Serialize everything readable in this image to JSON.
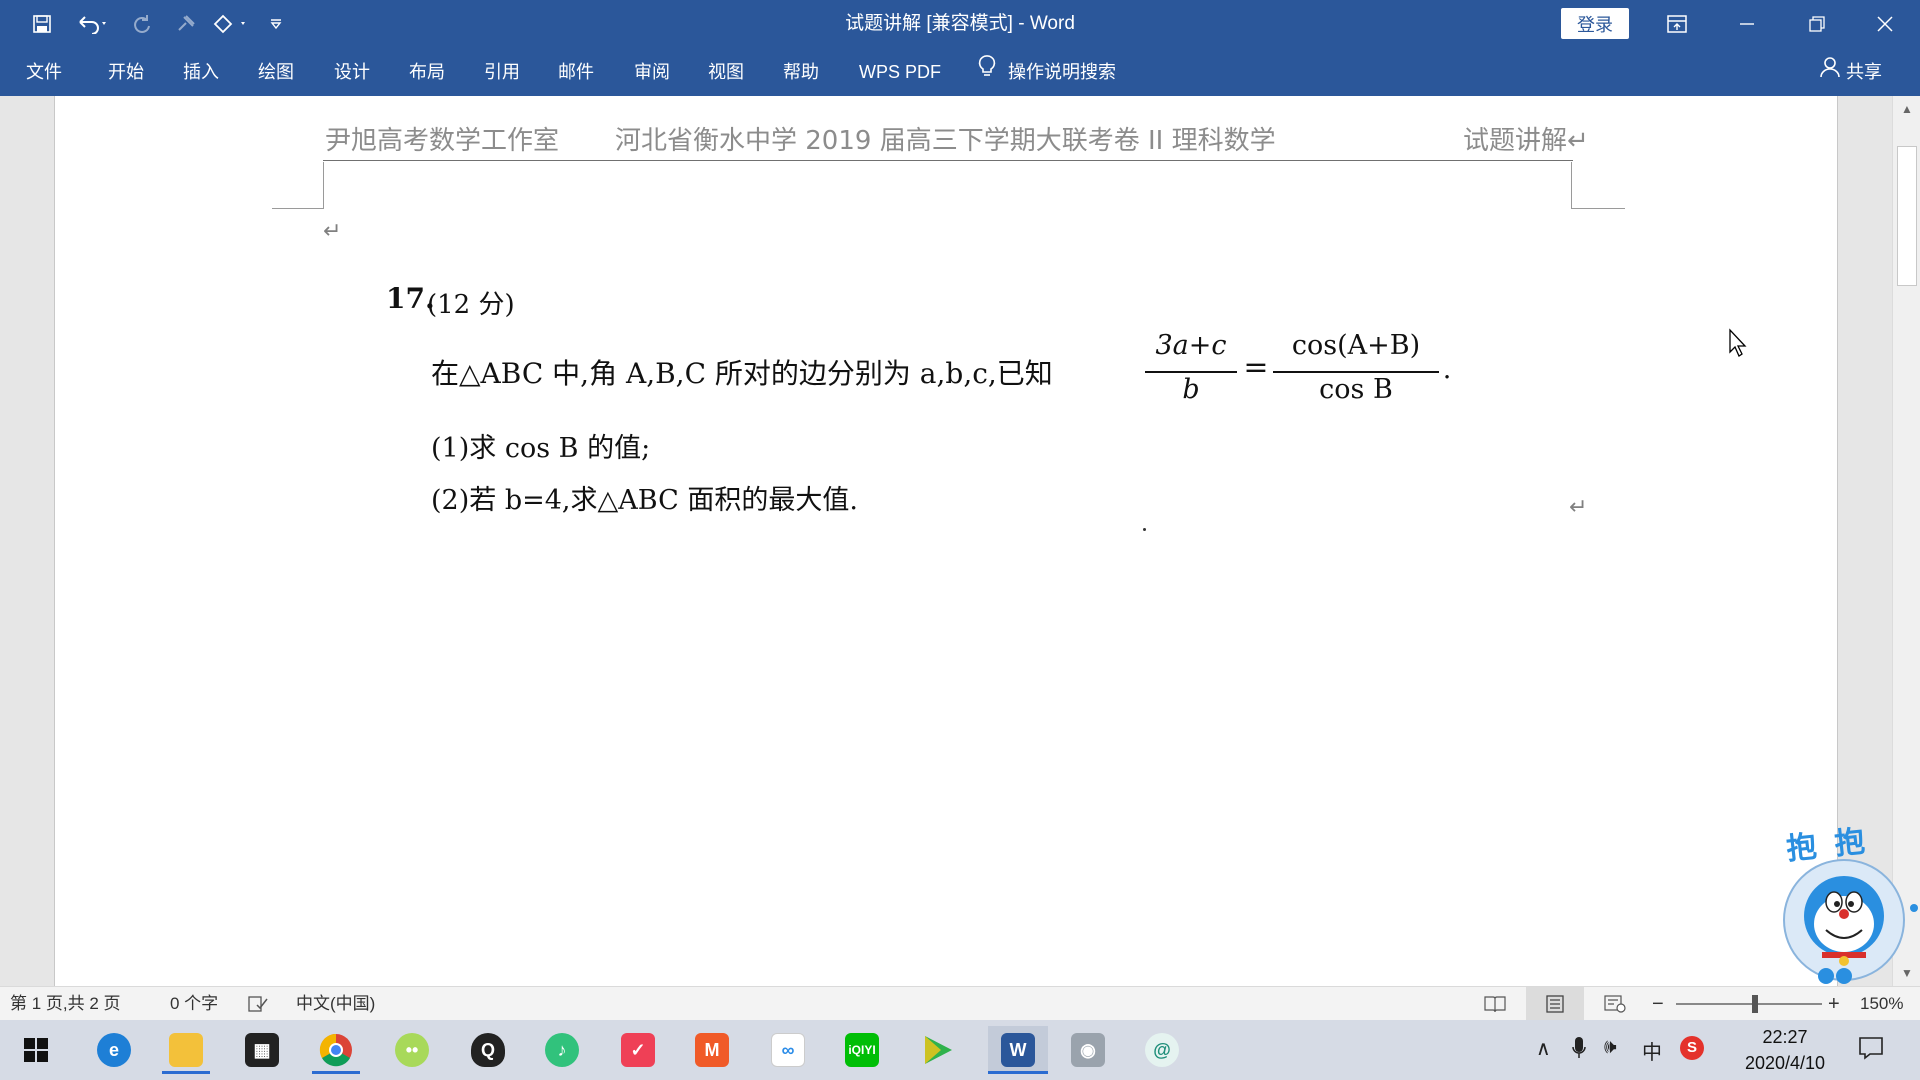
{
  "window": {
    "title": "试题讲解 [兼容模式]  -  Word",
    "login_label": "登录"
  },
  "ribbon": {
    "tabs": [
      "文件",
      "开始",
      "插入",
      "绘图",
      "设计",
      "布局",
      "引用",
      "邮件",
      "审阅",
      "视图",
      "帮助",
      "WPS PDF"
    ],
    "tell_me": "操作说明搜索",
    "share": "共享"
  },
  "document": {
    "header": {
      "left": "尹旭高考数学工作室",
      "center": "河北省衡水中学 2019 届高三下学期大联考卷 II 理科数学",
      "right": "试题讲解↵"
    },
    "paragraph_mark": "↵",
    "question": {
      "number": "17.",
      "score": "(12 分)",
      "stem": "在△ABC 中,角 A,B,C 所对的边分别为 a,b,c,已知",
      "frac1_num": "3a+c",
      "frac1_den": "b",
      "equals": "=",
      "frac2_num": "cos(A+B)",
      "frac2_den": "cos B",
      "period": ".",
      "part1": "(1)求 cos B 的值;",
      "part2": "(2)若 b=4,求△ABC 面积的最大值."
    }
  },
  "status": {
    "page": "第 1 页,共 2 页",
    "words": "0 个字",
    "language": "中文(中国)",
    "zoom": "150%"
  },
  "mascot": {
    "text": "抱 抱"
  },
  "taskbar": {
    "time": "22:27",
    "date": "2020/4/10",
    "ime": "中"
  },
  "colors": {
    "word_blue": "#2b579a",
    "header_gray": "#8c8c8c"
  }
}
